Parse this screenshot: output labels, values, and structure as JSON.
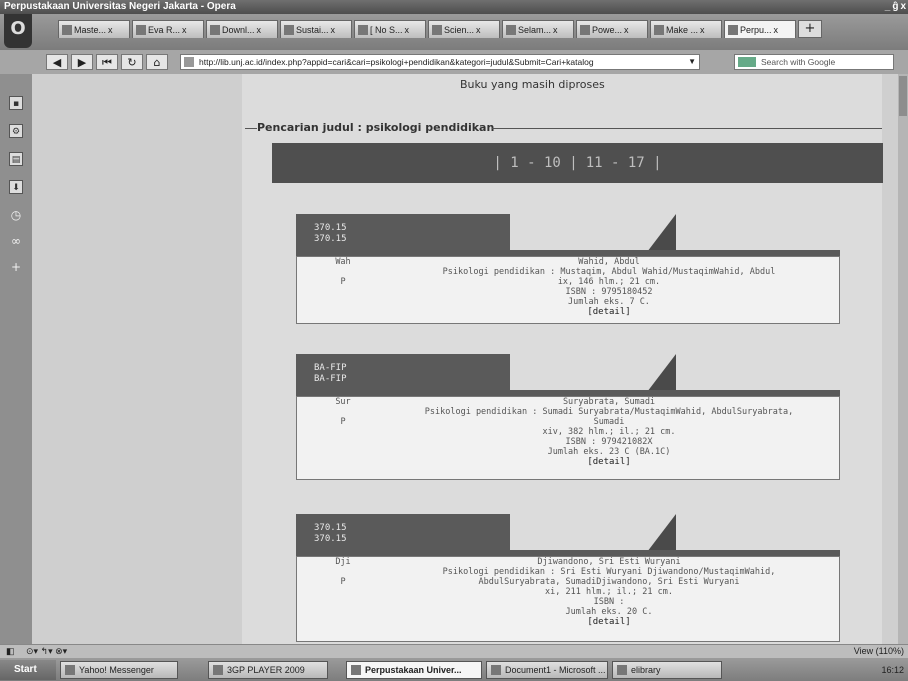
{
  "window": {
    "title": "Perpustakaan Universitas Negeri Jakarta - Opera",
    "controls": [
      "_",
      "ĝ",
      "x"
    ]
  },
  "tabs": [
    {
      "label": "Maste...",
      "active": false
    },
    {
      "label": "Eva R...",
      "active": false
    },
    {
      "label": "Downl...",
      "active": false
    },
    {
      "label": "Sustai...",
      "active": false
    },
    {
      "label": "[ No S...",
      "active": false
    },
    {
      "label": "Scien...",
      "active": false
    },
    {
      "label": "Selam...",
      "active": false
    },
    {
      "label": "Powe...",
      "active": false
    },
    {
      "label": "Make ...",
      "active": false
    },
    {
      "label": "Perpu...",
      "active": true
    }
  ],
  "tab_close": "x",
  "new_tab": "+",
  "nav": {
    "back": "◀",
    "forward": "▶",
    "rewind": "⏮",
    "reload": "↻",
    "home": "⌂",
    "address": "http://lib.unj.ac.id/index.php?appid=cari&cari=psikologi+pendidikan&kategori=judul&Submit=Cari+katalog",
    "search_placeholder": "Search with Google"
  },
  "page": {
    "processing_text": "Buku yang masih diproses",
    "section_title": "Pencarian judul : psikologi pendidikan",
    "pagination": [
      "| 1 - 10 |",
      "11 - 17 |"
    ]
  },
  "records": [
    {
      "call_number": [
        "370.15",
        "370.15"
      ],
      "col1": [
        "Wah",
        "P"
      ],
      "lines": [
        "Wahid, Abdul",
        "Psikologi pendidikan : Mustaqim, Abdul Wahid/MustaqimWahid, Abdul",
        "ix, 146 hlm.; 21 cm.",
        "ISBN : 9795180452",
        "Jumlah eks. 7 C."
      ],
      "detail": "[detail]"
    },
    {
      "call_number": [
        "BA-FIP",
        "BA-FIP"
      ],
      "col1": [
        "Sur",
        "P"
      ],
      "lines": [
        "Suryabrata, Sumadi",
        "Psikologi pendidikan : Sumadi Suryabrata/MustaqimWahid, AbdulSuryabrata,",
        "Sumadi",
        "xiv, 382 hlm.; il.; 21 cm.",
        "ISBN : 979421082X",
        "Jumlah eks. 23 C (BA.1C)"
      ],
      "detail": "[detail]"
    },
    {
      "call_number": [
        "370.15",
        "370.15"
      ],
      "col1": [
        "Dji",
        "P"
      ],
      "lines": [
        "Djiwandono, Sri Esti Wuryani",
        "Psikologi pendidikan : Sri Esti Wuryani Djiwandono/MustaqimWahid,",
        "AbdulSuryabrata, SumadiDjiwandono, Sri Esti Wuryani",
        "xi, 211 hlm.; il.; 21 cm.",
        "ISBN :",
        "Jumlah eks. 20 C."
      ],
      "detail": "[detail]"
    }
  ],
  "status": {
    "zoom": "View (110%)"
  },
  "taskbar": {
    "start": "Start",
    "items": [
      "Yahoo! Messenger",
      "3GP PLAYER 2009",
      "Perpustakaan Univer...",
      "Document1 - Microsoft ...",
      "elibrary"
    ],
    "clock": "16:12"
  }
}
